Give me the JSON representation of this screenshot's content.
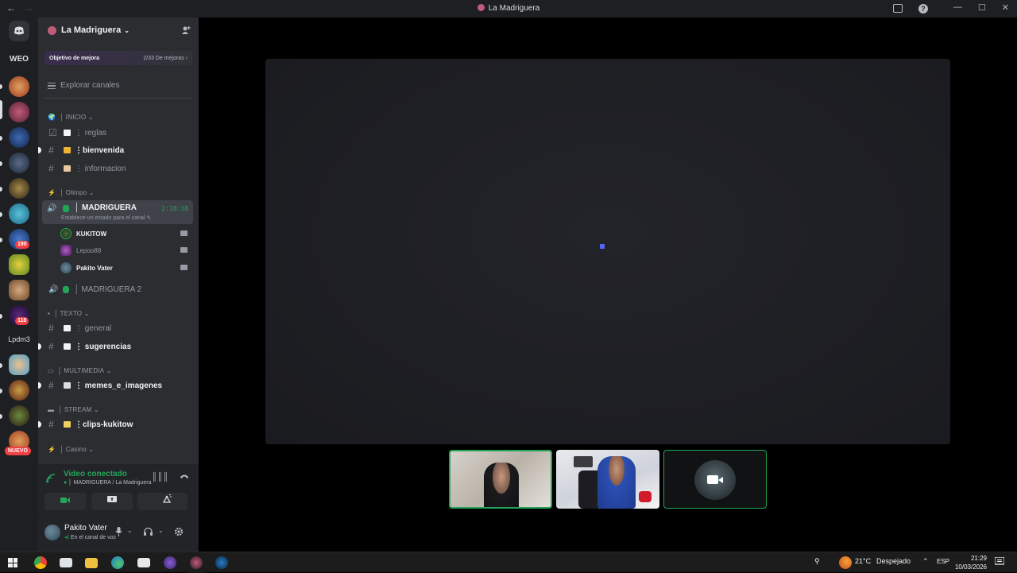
{
  "window": {
    "title": "La Madriguera",
    "nav_back": "←",
    "nav_forward": "→",
    "minimize": "—",
    "maximize": "☐",
    "close": "✕",
    "help": "?"
  },
  "guilds": {
    "items": [
      {
        "label": "WEO"
      },
      {
        "label": "Lpdm3"
      }
    ],
    "badges": [
      "190",
      "118"
    ],
    "new_badge": "NUEVO"
  },
  "server": {
    "name": "La Madriguera",
    "chevron": "⌄",
    "boost_goal_label": "Objetivo de mejora",
    "boost_goal_progress": "2/33 De mejoras",
    "boost_goal_arrow": "›",
    "boost_current": 2,
    "boost_target": 33,
    "browse_channels": "Explorar canales"
  },
  "categories": {
    "inicio": {
      "label": "INICIO",
      "chevron": "⌄"
    },
    "olimpo": {
      "label": "Olimpo",
      "chevron": "⌄"
    },
    "texto": {
      "label": "TEXTO",
      "chevron": "⌄"
    },
    "multimedia": {
      "label": "MULTIMEDIA",
      "chevron": "⌄"
    },
    "stream": {
      "label": "STREAM",
      "chevron": "⌄"
    },
    "casino": {
      "label": "Casino",
      "chevron": "⌄"
    }
  },
  "channels": {
    "reglas": "reglas",
    "bienvenida": "bienvenida",
    "informacion": "informacion",
    "general": "general",
    "sugerencias": "sugerencias",
    "memes": "memes_e_imagenes",
    "clips": "clips-kukitow",
    "separator": "⋮",
    "hash": "#"
  },
  "voice": {
    "madriguera": {
      "name": "MADRIGUERA",
      "timer": "2:18:18",
      "status": "Establece un estado para el canal",
      "edit_icon": "✎",
      "members": [
        {
          "name": "KUKITOW",
          "live": true
        },
        {
          "name": "Lepoo88",
          "live": false
        },
        {
          "name": "Pakito Vater",
          "live": true
        }
      ]
    },
    "madriguera2": {
      "name": "MADRIGUERA 2"
    }
  },
  "rtc": {
    "title": "Video conectado",
    "subtitle": "MADRIGUERA / La Madriguera",
    "buttons": [
      "camera",
      "screen-share",
      "activities",
      "soundboard"
    ]
  },
  "user_panel": {
    "name": "Pakito Vater",
    "status": "En el canal de voz"
  },
  "taskbar": {
    "weather_temp": "21°C",
    "weather_desc": "Despejado",
    "chevron": "⌃",
    "lang": "ESP",
    "time": "21:29",
    "date": "10/03/2026"
  },
  "colors": {
    "accent_green": "#23a559",
    "blurple": "#5865f2",
    "danger_red": "#f23f43"
  },
  "icons": {
    "discord": "discord-icon",
    "speaker": "speaker-icon",
    "camera": "camera-icon",
    "signal": "signal-icon",
    "hangup": "hangup-icon",
    "mic": "mic-icon",
    "headphones": "headphones-icon",
    "settings": "gear-icon"
  }
}
